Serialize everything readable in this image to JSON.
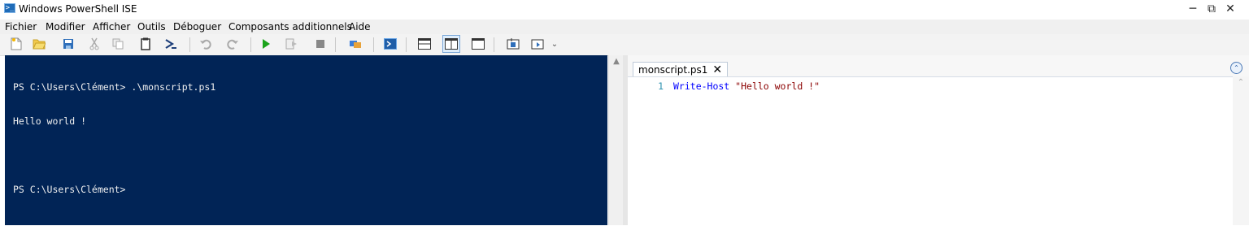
{
  "window": {
    "title": "Windows PowerShell ISE",
    "icon": "powershell-icon",
    "controls": {
      "minimize": "─",
      "maximize": "⧉",
      "close": "✕"
    }
  },
  "menubar": {
    "items": [
      "Fichier",
      "Modifier",
      "Afficher",
      "Outils",
      "Déboguer",
      "Composants additionnels",
      "Aide"
    ]
  },
  "toolbar": {
    "overflow_glyph": "⌄",
    "icons": [
      "new-script-icon",
      "open-icon",
      "save-icon",
      "cut-icon",
      "copy-icon",
      "paste-icon",
      "prompt-icon",
      "undo-icon",
      "redo-icon",
      "run-icon",
      "run-selection-icon",
      "stop-icon",
      "remote-session-icon",
      "start-powershell-icon",
      "show-script-pane-top-icon",
      "show-script-pane-right-icon",
      "show-script-pane-maximized-icon",
      "show-command-window-icon",
      "show-command-addon-icon"
    ]
  },
  "console": {
    "lines": [
      "PS C:\\Users\\Clément> .\\monscript.ps1",
      "Hello world !",
      "",
      "PS C:\\Users\\Clément>"
    ],
    "background": "#012456",
    "foreground": "#f0f0f0"
  },
  "editor": {
    "tab_label": "monscript.ps1",
    "tab_close": "✕",
    "collapse_glyph": "⌃",
    "line_number": "1",
    "keyword": "Write-Host",
    "string": " \"Hello world !\""
  },
  "colors": {
    "keyword": "#0000ff",
    "string": "#8b0000",
    "line_number": "#2b91af",
    "accent": "#1e6bb8"
  }
}
